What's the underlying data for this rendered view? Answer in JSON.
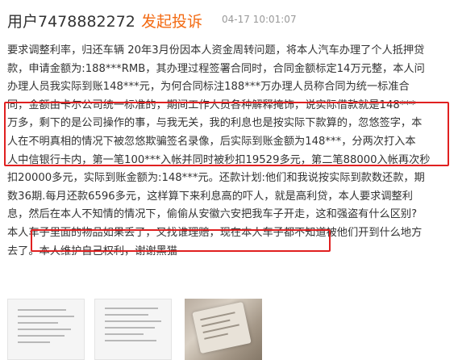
{
  "header": {
    "username": "用户7478882272",
    "complaint_link": "发起投诉",
    "timestamp": "04-17 10:01:07"
  },
  "post": {
    "lines": [
      "要求调整利率，归还车辆 20年3月份因本人资金周转问题，将本人汽车办理了个人抵押贷",
      "款，申请金额为:188***RMB，其办理过程签署合同时，合同金额标定14万元整，本人问",
      "办理人员我实际到账148***元，为何合同标注188***万办理人员称合同为统一标准合",
      "同，金额由卡尔公司统一标准的，期间工作人员各种解释掩饰，说实际借款就是148***",
      "万多，剩下的是公司操作的事，与我无关，我的利息也是按实际下款算的，忽悠签字，本",
      "人在不明真相的情况下被忽悠欺骗签名录像，后实际到账金额为148***，分两次打入本",
      "人中信银行卡内，第一笔100***入帐并同时被秒扣19529多元，第二笔88000入帐再次秒",
      "扣20000多元，实际到账金额为:148***元。还款计划:他们和我说按实际到款数还款，期",
      "数36期.每月还款6596多元，这样算下来利息高的吓人，就是高利贷，本人要求调整利",
      "息，然后在本人不知情的情况下，偷偷从安徽六安把我车子开走，这和强盗有什么区别?",
      "本人车子里面的物品如果丢了，又找谁理赔，现在本人车子都不知道被他们开到什么地方",
      "去了。本人维护自己权利，谢谢黑猫"
    ]
  },
  "attachments": [
    {
      "icon": "document-thumbnail-icon"
    },
    {
      "icon": "document-thumbnail-icon"
    },
    {
      "icon": "photo-thumbnail-icon"
    }
  ],
  "colors": {
    "accent": "#f36a12",
    "highlight_border": "#e02020",
    "text": "#333333",
    "muted": "#999999"
  }
}
